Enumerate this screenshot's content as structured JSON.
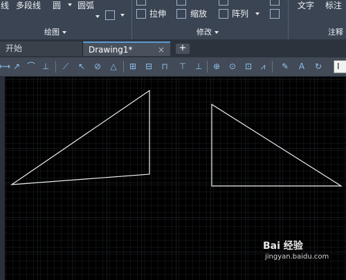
{
  "ribbon": {
    "draw_row1": [
      "线",
      "多段线",
      "圆",
      "圆弧"
    ],
    "modify_row2": [
      "拉伸",
      "缩放",
      "阵列"
    ],
    "annotate_row1": [
      "文字",
      "标注"
    ],
    "panel_draw": "绘图",
    "panel_modify": "修改",
    "panel_annotate": "注释"
  },
  "tabs": {
    "start": "开始",
    "drawing": "Drawing1*",
    "close_icon": "×",
    "add_icon": "+"
  },
  "toolbar": {
    "field_value": "I"
  },
  "watermark": {
    "logo": "Bai 经验",
    "url": "jingyan.baidu.com"
  }
}
